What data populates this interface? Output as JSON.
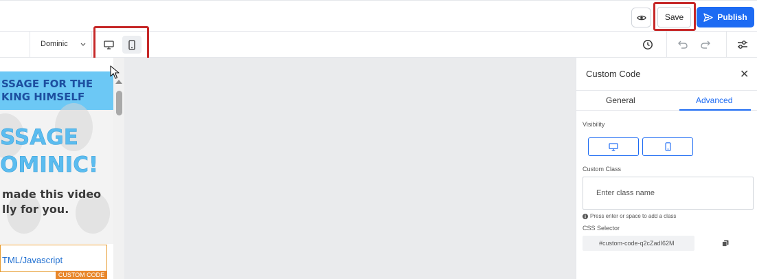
{
  "topbar": {
    "save_label": "Save",
    "publish_label": "Publish",
    "preview_icon": "eye-icon"
  },
  "toolbar": {
    "page_selector": "Dominic",
    "devices": [
      "desktop-icon",
      "mobile-icon"
    ],
    "active_device": "mobile",
    "right_icons": [
      "history-icon",
      "undo-icon",
      "redo-icon",
      "settings-sliders-icon"
    ]
  },
  "preview": {
    "banner_line1": "SSAGE FOR THE",
    "banner_line2": "KING HIMSELF",
    "hero_line1": "SSAGE",
    "hero_line2": "OMINIC!",
    "hero_sub1": "made this video",
    "hero_sub2": "lly for you.",
    "code_text": "TML/Javascript",
    "code_tag": "CUSTOM CODE"
  },
  "panel": {
    "title": "Custom Code",
    "tabs": [
      {
        "label": "General",
        "active": false
      },
      {
        "label": "Advanced",
        "active": true
      }
    ],
    "visibility_label": "Visibility",
    "custom_class_label": "Custom Class",
    "class_placeholder": "Enter class name",
    "hint": "Press enter or space to add a class",
    "css_selector_label": "CSS Selector",
    "css_selector_value": "#custom-code-q2cZadI62M"
  },
  "colors": {
    "accent": "#1d6bf3",
    "highlight": "#c62828",
    "code_tag": "#e8862a"
  }
}
